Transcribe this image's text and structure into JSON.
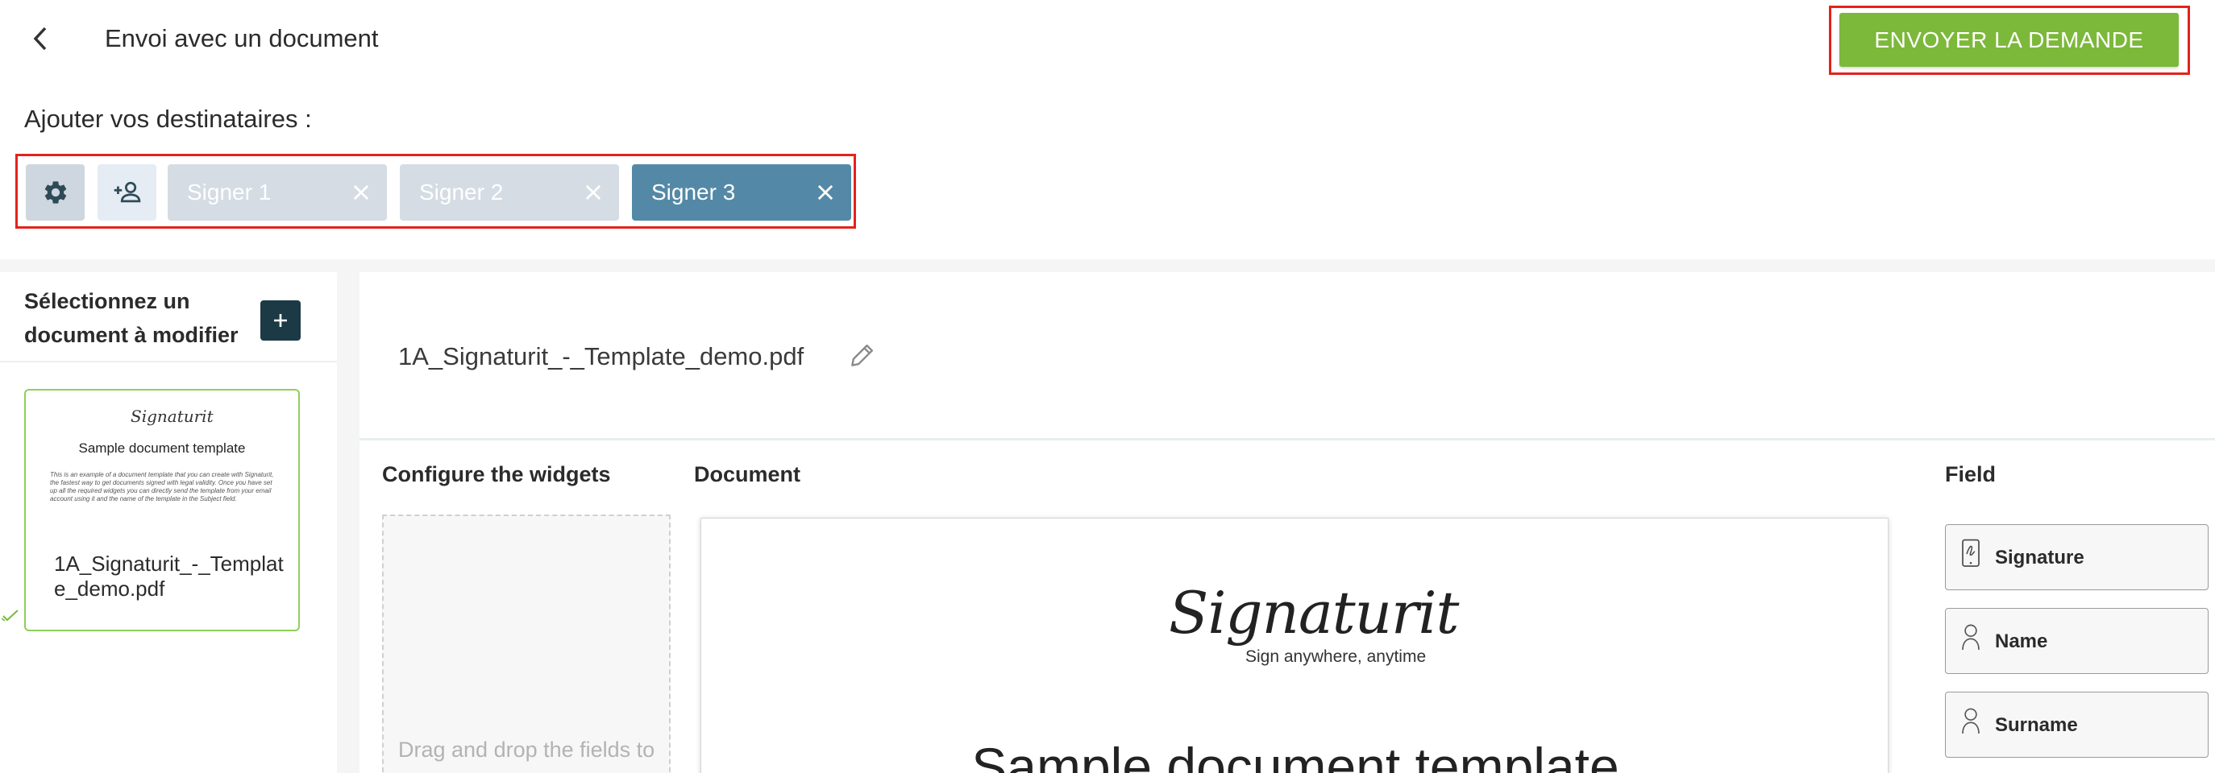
{
  "header": {
    "back_icon": "chevron-left-icon",
    "title": "Envoi avec un document",
    "send_label": "ENVOYER LA DEMANDE",
    "send_color": "#7cb83a"
  },
  "recipients": {
    "title": "Ajouter vos destinataires :",
    "settings_icon": "gear-icon",
    "add_icon": "person-add-icon",
    "signers": [
      {
        "label": "Signer 1",
        "active": false
      },
      {
        "label": "Signer 2",
        "active": false
      },
      {
        "label": "Signer 3",
        "active": true
      }
    ],
    "active_color": "#5389a6",
    "inactive_color": "#d5dce4"
  },
  "sidebar": {
    "title": "Sélectionnez un document à modifier",
    "add_icon": "plus-icon",
    "documents": [
      {
        "name": "1A_Signaturit_-_Template_demo.pdf",
        "thumb_logo": "Signaturit",
        "thumb_title": "Sample document template",
        "thumb_text": "This is an example of a document template that you can create with Signaturit, the fastest way to get documents signed with legal validity. Once you have set up all the required widgets you can directly send the template from your email account using it and the name of the template in the Subject field."
      }
    ]
  },
  "main": {
    "file_name": "1A_Signaturit_-_Template_demo.pdf",
    "edit_icon": "pencil-icon",
    "widgets_title": "Configure the widgets",
    "drop_text": "Drag and drop the fields to",
    "document_title": "Document",
    "document_logo": "Signaturit",
    "document_tagline": "Sign anywhere, anytime",
    "document_heading": "Sample document template",
    "field_title": "Field",
    "fields": [
      {
        "label": "Signature",
        "icon": "signature-icon"
      },
      {
        "label": "Name",
        "icon": "person-icon"
      },
      {
        "label": "Surname",
        "icon": "person-icon"
      }
    ]
  }
}
